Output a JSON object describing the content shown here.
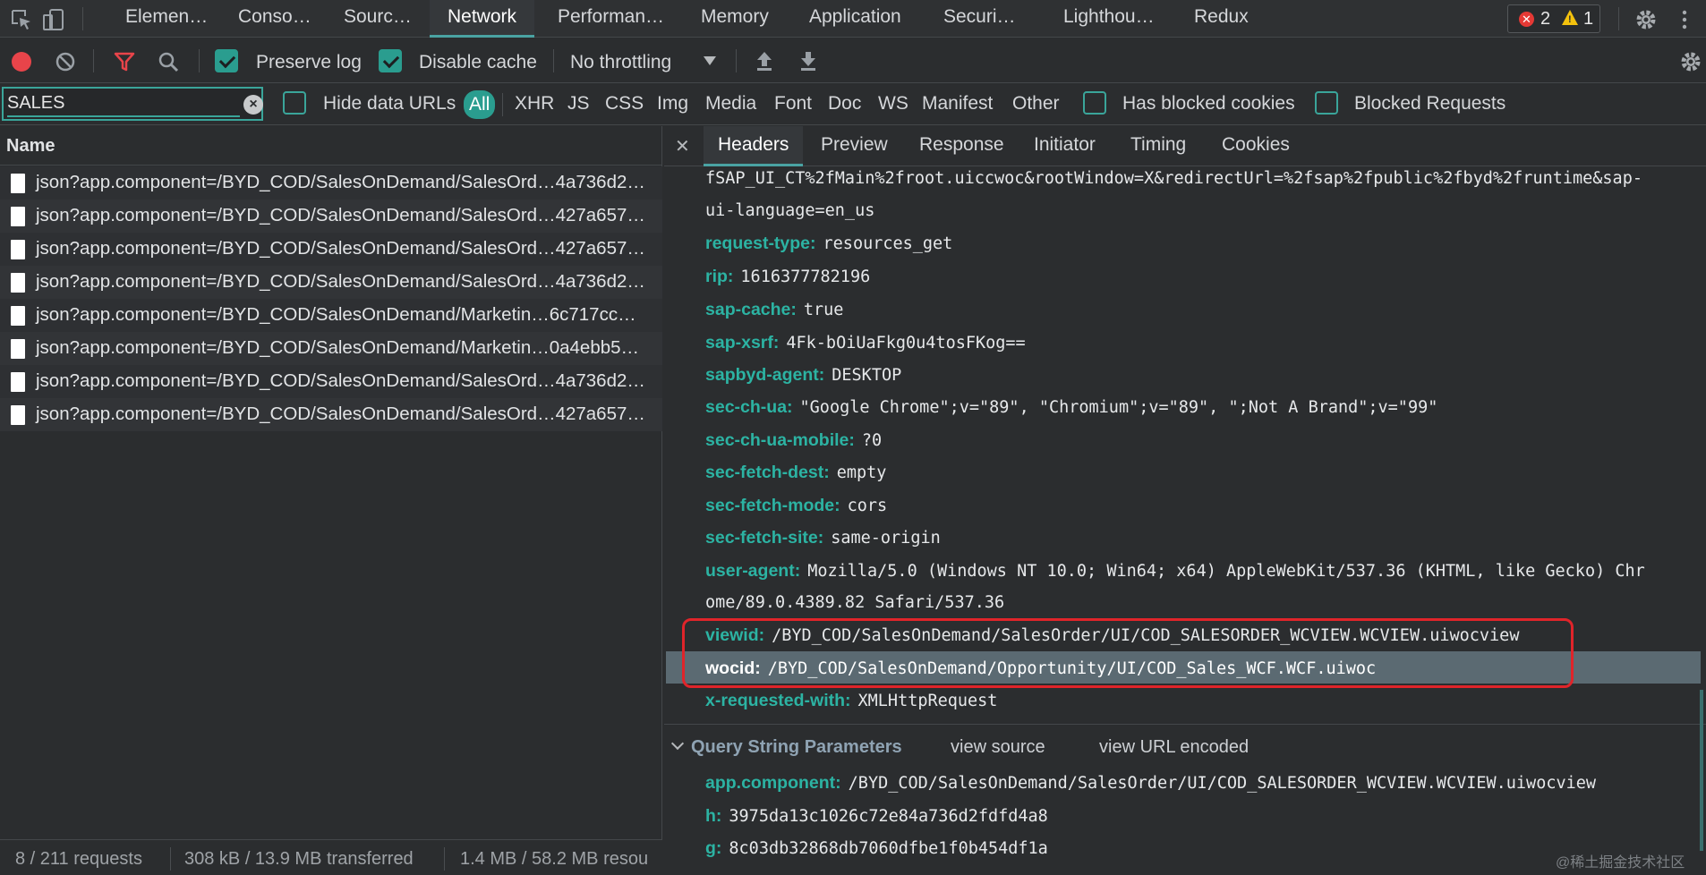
{
  "topbar": {
    "tabs": [
      {
        "label": "Elemen…"
      },
      {
        "label": "Conso…"
      },
      {
        "label": "Sourc…"
      },
      {
        "label": "Network"
      },
      {
        "label": "Performan…"
      },
      {
        "label": "Memory"
      },
      {
        "label": "Application"
      },
      {
        "label": "Securi…"
      },
      {
        "label": "Lighthou…"
      },
      {
        "label": "Redux"
      }
    ],
    "error_count": "2",
    "warning_count": "1"
  },
  "toolbar": {
    "preserve_log_label": "Preserve log",
    "disable_cache_label": "Disable cache",
    "throttling_value": "No throttling"
  },
  "filter": {
    "value": "SALES",
    "hide_data_urls_label": "Hide data URLs",
    "types": [
      "All",
      "XHR",
      "JS",
      "CSS",
      "Img",
      "Media",
      "Font",
      "Doc",
      "WS",
      "Manifest",
      "Other"
    ],
    "has_blocked_cookies_label": "Has blocked cookies",
    "blocked_requests_label": "Blocked Requests"
  },
  "requests": {
    "column_name": "Name",
    "rows": [
      "json?app.component=/BYD_COD/SalesOnDemand/SalesOrd…4a736d2…",
      "json?app.component=/BYD_COD/SalesOnDemand/SalesOrd…427a657…",
      "json?app.component=/BYD_COD/SalesOnDemand/SalesOrd…427a657…",
      "json?app.component=/BYD_COD/SalesOnDemand/SalesOrd…4a736d2…",
      "json?app.component=/BYD_COD/SalesOnDemand/Marketin…6c717cc…",
      "json?app.component=/BYD_COD/SalesOnDemand/Marketin…0a4ebb5…",
      "json?app.component=/BYD_COD/SalesOnDemand/SalesOrd…4a736d2…",
      "json?app.component=/BYD_COD/SalesOnDemand/SalesOrd…427a657…"
    ]
  },
  "statusbar": {
    "requests": "8 / 211 requests",
    "transferred": "308 kB / 13.9 MB transferred",
    "resources": "1.4 MB / 58.2 MB resou"
  },
  "details": {
    "tabs": [
      "Headers",
      "Preview",
      "Response",
      "Initiator",
      "Timing",
      "Cookies"
    ],
    "url_tail_1": "fSAP_UI_CT%2fMain%2froot.uiccwoc&rootWindow=X&redirectUrl=%2fsap%2fpublic%2fbyd%2fruntime&sap-",
    "url_tail_2": "ui-language=en_us",
    "headers": [
      {
        "key": "request-type:",
        "value": "resources_get"
      },
      {
        "key": "rip:",
        "value": "1616377782196"
      },
      {
        "key": "sap-cache:",
        "value": "true"
      },
      {
        "key": "sap-xsrf:",
        "value": "4Fk-bOiUaFkg0u4tosFKog=="
      },
      {
        "key": "sapbyd-agent:",
        "value": "DESKTOP"
      },
      {
        "key": "sec-ch-ua:",
        "value": "\"Google Chrome\";v=\"89\", \"Chromium\";v=\"89\", \";Not A Brand\";v=\"99\""
      },
      {
        "key": "sec-ch-ua-mobile:",
        "value": "?0"
      },
      {
        "key": "sec-fetch-dest:",
        "value": "empty"
      },
      {
        "key": "sec-fetch-mode:",
        "value": "cors"
      },
      {
        "key": "sec-fetch-site:",
        "value": "same-origin"
      },
      {
        "key": "user-agent:",
        "value": "Mozilla/5.0 (Windows NT 10.0; Win64; x64) AppleWebKit/537.36 (KHTML, like Gecko) Chr"
      },
      {
        "key": "viewid:",
        "value": "/BYD_COD/SalesOnDemand/SalesOrder/UI/COD_SALESORDER_WCVIEW.WCVIEW.uiwocview"
      },
      {
        "key": "wocid:",
        "value": "/BYD_COD/SalesOnDemand/Opportunity/UI/COD_Sales_WCF.WCF.uiwoc"
      },
      {
        "key": "x-requested-with:",
        "value": "XMLHttpRequest"
      }
    ],
    "user_agent_cont": "ome/89.0.4389.82 Safari/537.36",
    "query_section_title": "Query String Parameters",
    "view_source_label": "view source",
    "view_url_encoded_label": "view URL encoded",
    "query_params": [
      {
        "key": "app.component:",
        "value": "/BYD_COD/SalesOnDemand/SalesOrder/UI/COD_SALESORDER_WCVIEW.WCVIEW.uiwocview"
      },
      {
        "key": "h:",
        "value": "3975da13c1026c72e84a736d2fdfd4a8"
      },
      {
        "key": "g:",
        "value": "8c03db32868db7060dfbe1f0b454df1a"
      }
    ]
  },
  "watermark": "@稀土掘金技术社区"
}
